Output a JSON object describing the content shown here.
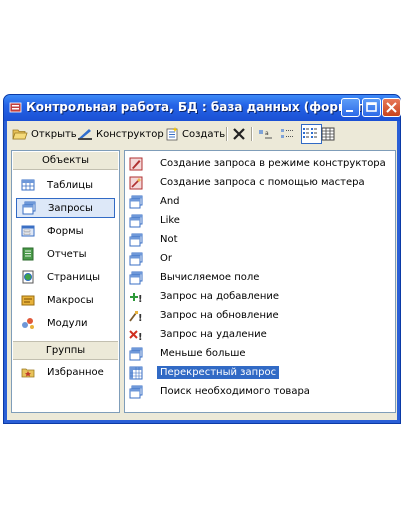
{
  "window": {
    "title": "Контрольная работа, БД : база данных (формат ..."
  },
  "toolbar": {
    "open": "Открыть",
    "designer": "Конструктор",
    "create": "Создать"
  },
  "objects_header": "Объекты",
  "groups_header": "Группы",
  "objects": [
    {
      "label": "Таблицы",
      "icon": "table-icon"
    },
    {
      "label": "Запросы",
      "icon": "query-icon",
      "selected": true
    },
    {
      "label": "Формы",
      "icon": "form-icon"
    },
    {
      "label": "Отчеты",
      "icon": "report-icon"
    },
    {
      "label": "Страницы",
      "icon": "page-icon"
    },
    {
      "label": "Макросы",
      "icon": "macro-icon"
    },
    {
      "label": "Модули",
      "icon": "module-icon"
    }
  ],
  "groups": [
    {
      "label": "Избранное",
      "icon": "favorites-icon"
    }
  ],
  "queries": [
    {
      "label": "Создание запроса в режиме конструктора",
      "icon": "wizard-design-icon"
    },
    {
      "label": "Создание запроса с помощью мастера",
      "icon": "wizard-icon"
    },
    {
      "label": "And",
      "icon": "query-icon"
    },
    {
      "label": "Like",
      "icon": "query-icon"
    },
    {
      "label": "Not",
      "icon": "query-icon"
    },
    {
      "label": "Or",
      "icon": "query-icon"
    },
    {
      "label": "Вычисляемое поле",
      "icon": "query-icon"
    },
    {
      "label": "Запрос на добавление",
      "icon": "append-query-icon"
    },
    {
      "label": "Запрос на обновление",
      "icon": "update-query-icon"
    },
    {
      "label": "Запрос на удаление",
      "icon": "delete-query-icon"
    },
    {
      "label": "Меньше больше",
      "icon": "query-icon"
    },
    {
      "label": "Перекрестный запрос",
      "icon": "crosstab-query-icon",
      "selected": true
    },
    {
      "label": "Поиск необходимого товара",
      "icon": "query-icon"
    }
  ]
}
